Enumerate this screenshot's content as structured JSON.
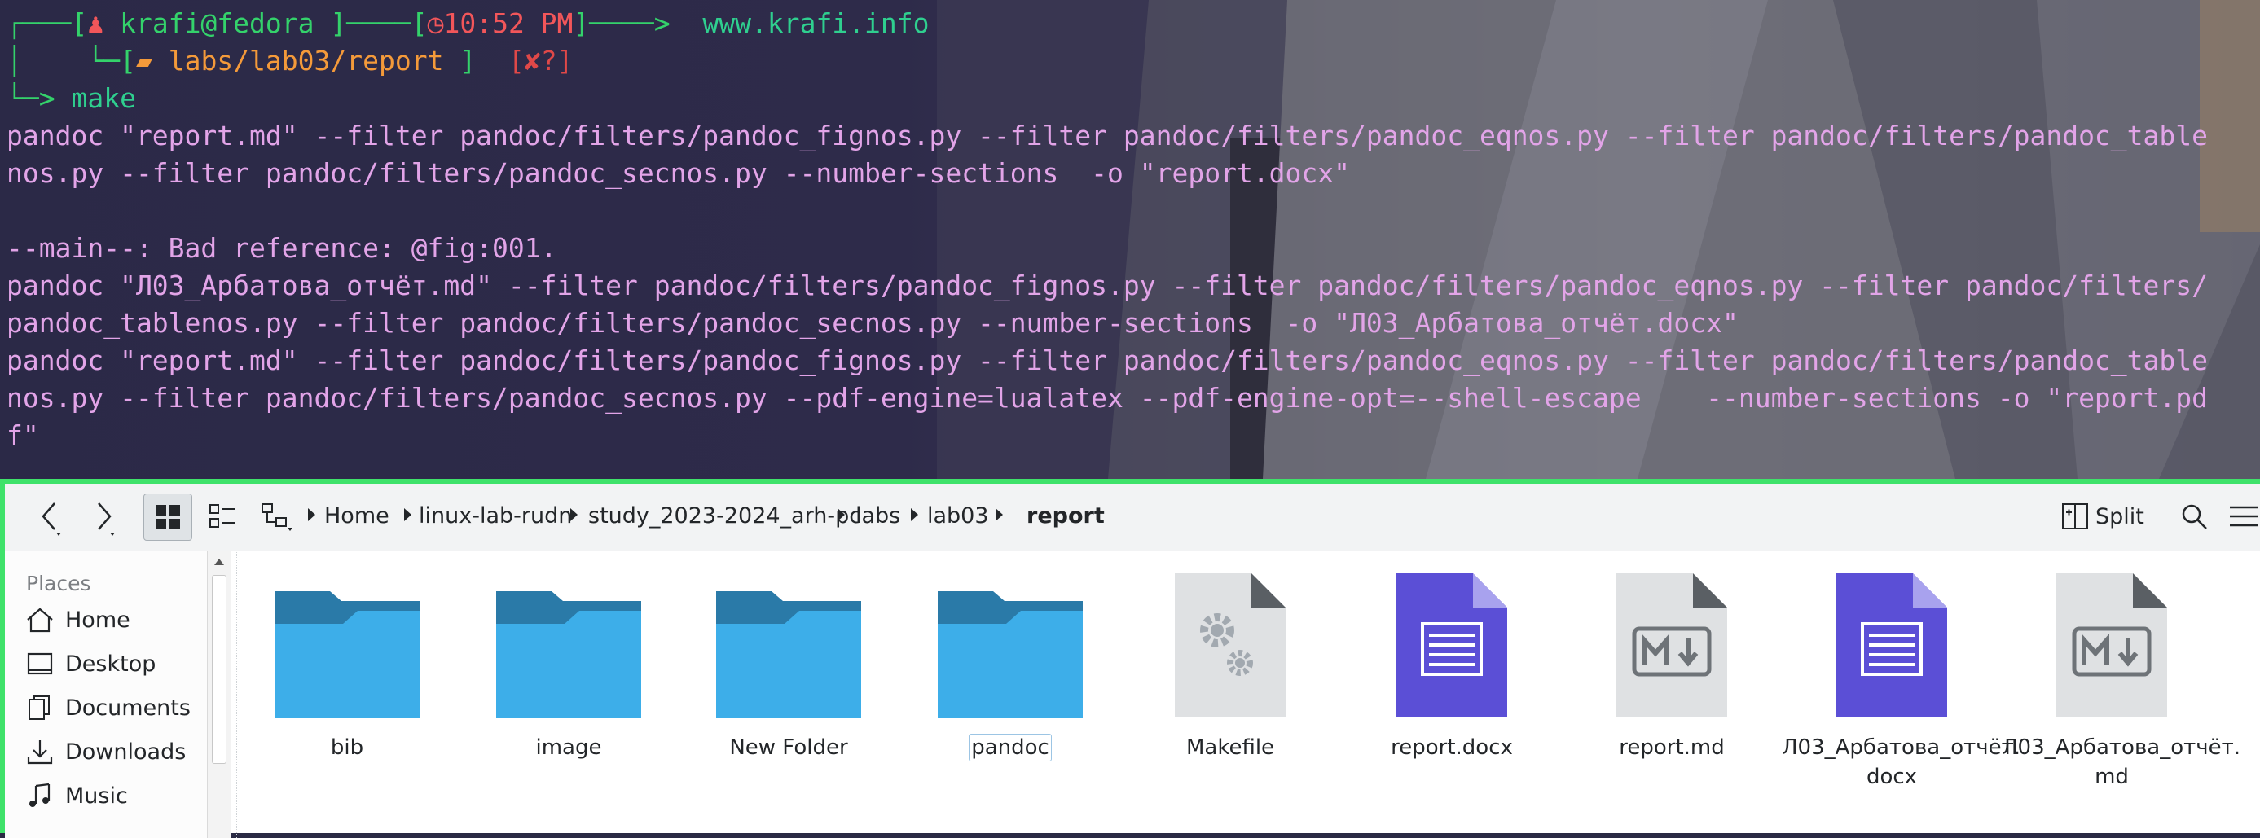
{
  "terminal": {
    "prompt_user": "krafi@fedora",
    "prompt_time": "10:52 PM",
    "prompt_site": "www.krafi.info",
    "prompt_path": "labs/lab03/report",
    "prompt_status": "[✘?]",
    "command": "make",
    "output_lines": [
      "pandoc \"report.md\" --filter pandoc/filters/pandoc_fignos.py --filter pandoc/filters/pandoc_eqnos.py --filter pandoc/filters/pandoc_table",
      "nos.py --filter pandoc/filters/pandoc_secnos.py --number-sections  -o \"report.docx\"",
      "",
      "--main--: Bad reference: @fig:001.",
      "pandoc \"Л03_Арбатова_отчёт.md\" --filter pandoc/filters/pandoc_fignos.py --filter pandoc/filters/pandoc_eqnos.py --filter pandoc/filters/",
      "pandoc_tablenos.py --filter pandoc/filters/pandoc_secnos.py --number-sections  -o \"Л03_Арбатова_отчёт.docx\"",
      "pandoc \"report.md\" --filter pandoc/filters/pandoc_fignos.py --filter pandoc/filters/pandoc_eqnos.py --filter pandoc/filters/pandoc_table",
      "nos.py --filter pandoc/filters/pandoc_secnos.py --pdf-engine=lualatex --pdf-engine-opt=--shell-escape    --number-sections -o \"report.pd",
      "f\""
    ]
  },
  "file_manager": {
    "breadcrumb": [
      "Home",
      "linux-lab-rudn",
      "study_2023-2024_arh-pc",
      "labs",
      "lab03"
    ],
    "current_folder": "report",
    "split_label": "Split",
    "sidebar": {
      "title": "Places",
      "items": [
        "Home",
        "Desktop",
        "Documents",
        "Downloads",
        "Music"
      ]
    },
    "files": [
      {
        "name": "bib",
        "type": "folder"
      },
      {
        "name": "image",
        "type": "folder"
      },
      {
        "name": "New Folder",
        "type": "folder"
      },
      {
        "name": "pandoc",
        "type": "folder"
      },
      {
        "name": "Makefile",
        "type": "makefile"
      },
      {
        "name": "report.docx",
        "type": "docx"
      },
      {
        "name": "report.md",
        "type": "markdown"
      },
      {
        "name": "Л03_Арбатова_отчёт.\ndocx",
        "type": "docx"
      },
      {
        "name": "Л03_Арбатова_отчёт.\nmd",
        "type": "markdown"
      }
    ]
  },
  "colors": {
    "folder_light": "#3daee9",
    "folder_dark": "#2a7aa8",
    "docx": "#5b4fd6",
    "terminal_output": "#e2a4e8",
    "window_border": "#3fe26a"
  }
}
